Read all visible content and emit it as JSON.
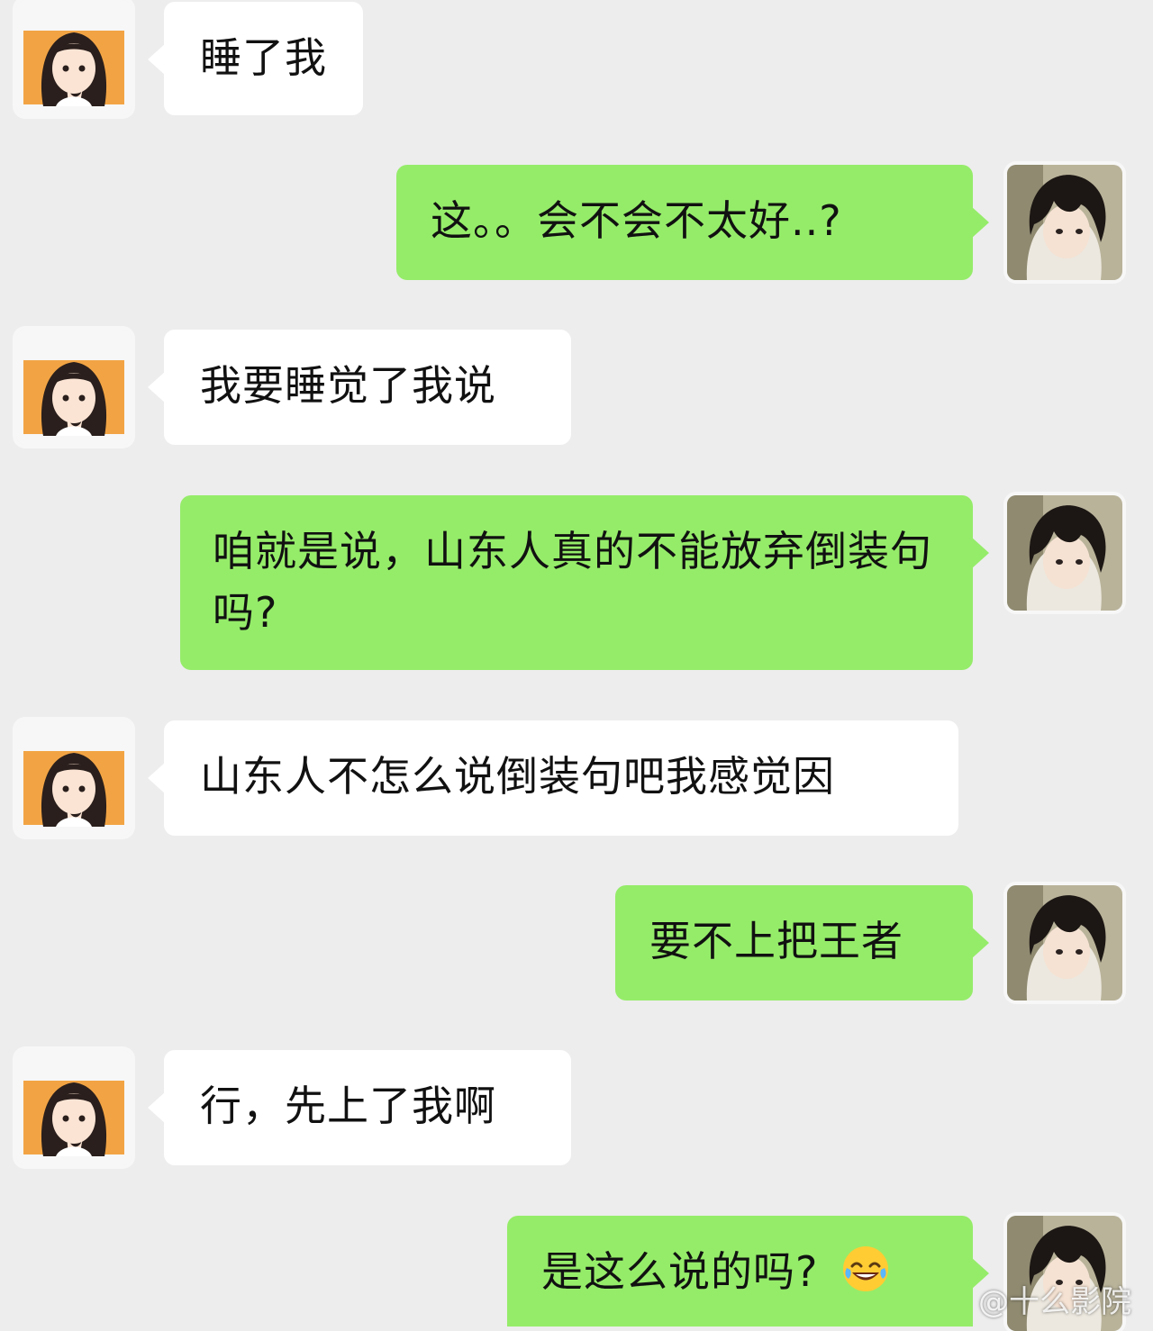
{
  "colors": {
    "background": "#ededed",
    "incoming_bubble": "#ffffff",
    "outgoing_bubble": "#95ec69",
    "girl_avatar_bg": "#f2a444"
  },
  "avatars": {
    "girl": "girl-avatar-icon",
    "boy": "boy-avatar-icon"
  },
  "messages": [
    {
      "side": "in",
      "text": "睡了我"
    },
    {
      "side": "out",
      "text": "这。。会不会不太好..?"
    },
    {
      "side": "in",
      "text": "我要睡觉了我说"
    },
    {
      "side": "out",
      "text": "咱就是说，山东人真的不能放弃倒装句吗?"
    },
    {
      "side": "in",
      "text": "山东人不怎么说倒装句吧我感觉因"
    },
    {
      "side": "out",
      "text": "要不上把王者"
    },
    {
      "side": "in",
      "text": "行，先上了我啊"
    },
    {
      "side": "out",
      "text": "是这么说的吗?",
      "emoji": "laughing-crying-emoji-icon"
    }
  ],
  "watermark": "@十么影院"
}
